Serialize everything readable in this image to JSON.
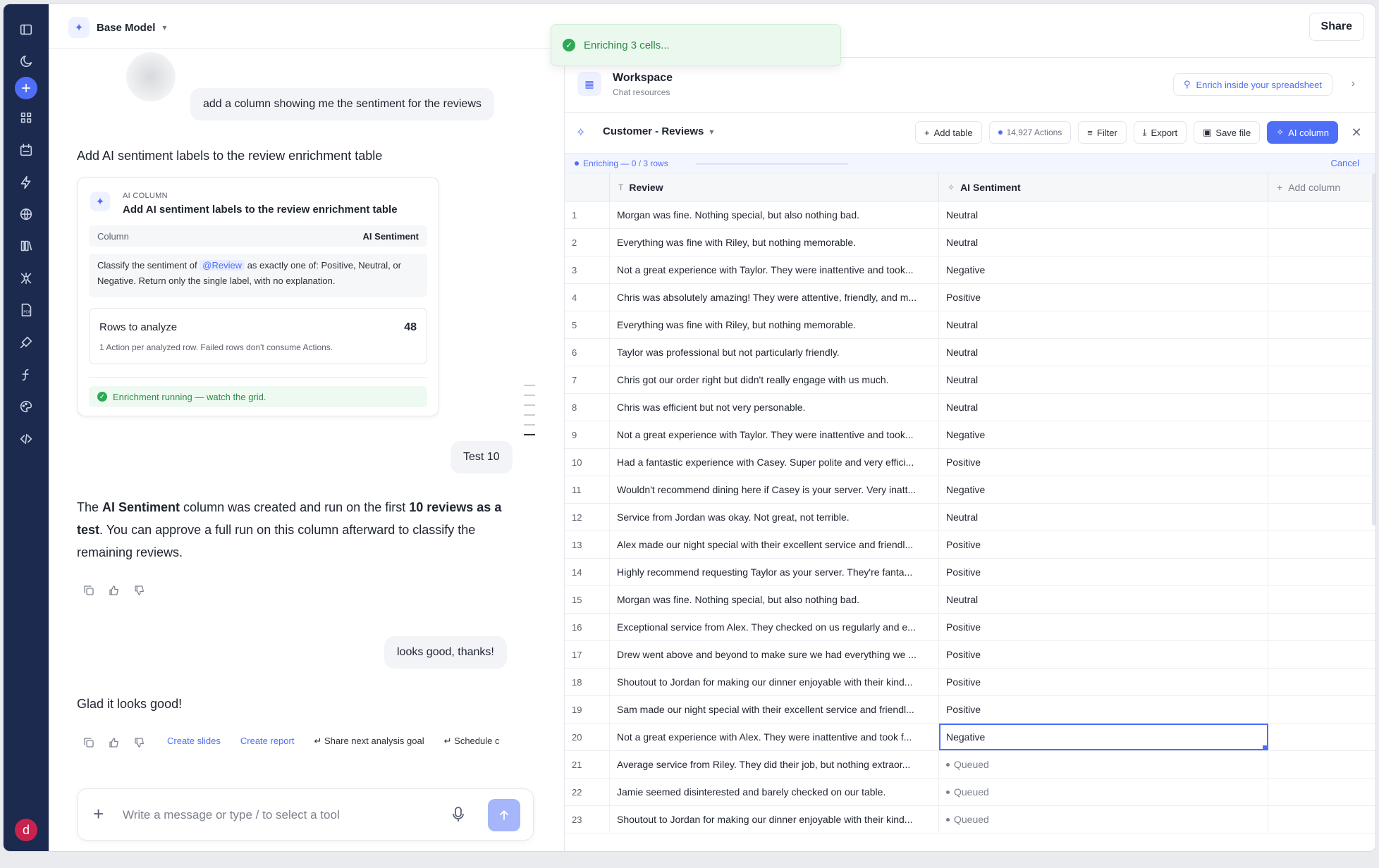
{
  "rail": {
    "items": [
      "sidebar-toggle-icon",
      "history-icon",
      "new-chat-icon",
      "apps-grid-icon",
      "calendar-icon",
      "bolt-icon",
      "globe-icon",
      "library-icon",
      "bug-icon",
      "pdf-icon",
      "plugin-icon",
      "function-icon",
      "palette-icon",
      "code-icon"
    ],
    "avatar": "d"
  },
  "header": {
    "model": "Base Model",
    "share": "Share"
  },
  "toast": {
    "text": "Enriching 3 cells..."
  },
  "chat": {
    "user_msg_1": "add a column showing me the sentiment for the reviews",
    "ai_heading": "Add AI sentiment labels to the review enrichment table",
    "card": {
      "eyebrow": "AI COLUMN",
      "title": "Add AI sentiment labels to the review enrichment table",
      "column_label": "Column",
      "column_value": "AI Sentiment",
      "prompt_before": "Classify the sentiment of",
      "prompt_mention": "@Review",
      "prompt_after": "as exactly one of: Positive, Neutral, or Negative. Return only the single label, with no explanation.",
      "rows_label": "Rows to analyze",
      "rows_value": "48",
      "rows_sub": "1 Action per analyzed row. Failed rows don't consume Actions.",
      "status": "Enrichment running — watch the grid."
    },
    "user_msg_2": "Test 10",
    "ai_reply": {
      "p1": "The ",
      "b1": "AI Sentiment",
      "p2": " column was created and run on the first ",
      "b2": "10 reviews as a test",
      "p3": ". You can approve a full run on this column afterward to classify the remaining reviews."
    },
    "user_msg_3": "looks good, thanks!",
    "ai_reply_2": "Glad it looks good!",
    "quick_actions": [
      "Create slides",
      "Create report",
      "Share next analysis goal",
      "Schedule c"
    ],
    "composer_placeholder": "Write a message or type / to select a tool"
  },
  "workspace": {
    "title": "Workspace",
    "subtitle": "Chat resources",
    "enrich_button": "Enrich inside your spreadsheet"
  },
  "table": {
    "name": "Customer - Reviews",
    "buttons": {
      "add_table": "Add table",
      "actions": "14,927 Actions",
      "filter": "Filter",
      "export": "Export",
      "save": "Save file",
      "ai_column": "AI column"
    },
    "progress": {
      "label": "Enriching — 0 / 3 rows",
      "fraction": 0.0,
      "cancel": "Cancel"
    },
    "columns": {
      "review": "Review",
      "sentiment": "AI Sentiment",
      "add": "Add column"
    },
    "rows": [
      {
        "n": "1",
        "review": "Morgan was fine. Nothing special, but also nothing bad.",
        "sentiment": "Neutral"
      },
      {
        "n": "2",
        "review": "Everything was fine with Riley, but nothing memorable.",
        "sentiment": "Neutral"
      },
      {
        "n": "3",
        "review": "Not a great experience with Taylor. They were inattentive and took...",
        "sentiment": "Negative"
      },
      {
        "n": "4",
        "review": "Chris was absolutely amazing! They were attentive, friendly, and m...",
        "sentiment": "Positive"
      },
      {
        "n": "5",
        "review": "Everything was fine with Riley, but nothing memorable.",
        "sentiment": "Neutral"
      },
      {
        "n": "6",
        "review": "Taylor was professional but not particularly friendly.",
        "sentiment": "Neutral"
      },
      {
        "n": "7",
        "review": "Chris got our order right but didn't really engage with us much.",
        "sentiment": "Neutral"
      },
      {
        "n": "8",
        "review": "Chris was efficient but not very personable.",
        "sentiment": "Neutral"
      },
      {
        "n": "9",
        "review": "Not a great experience with Taylor. They were inattentive and took...",
        "sentiment": "Negative"
      },
      {
        "n": "10",
        "review": "Had a fantastic experience with Casey. Super polite and very effici...",
        "sentiment": "Positive"
      },
      {
        "n": "11",
        "review": "Wouldn't recommend dining here if Casey is your server. Very inatt...",
        "sentiment": "Negative"
      },
      {
        "n": "12",
        "review": "Service from Jordan was okay. Not great, not terrible.",
        "sentiment": "Neutral"
      },
      {
        "n": "13",
        "review": "Alex made our night special with their excellent service and friendl...",
        "sentiment": "Positive"
      },
      {
        "n": "14",
        "review": "Highly recommend requesting Taylor as your server. They're fanta...",
        "sentiment": "Positive"
      },
      {
        "n": "15",
        "review": "Morgan was fine. Nothing special, but also nothing bad.",
        "sentiment": "Neutral"
      },
      {
        "n": "16",
        "review": "Exceptional service from Alex. They checked on us regularly and e...",
        "sentiment": "Positive"
      },
      {
        "n": "17",
        "review": "Drew went above and beyond to make sure we had everything we ...",
        "sentiment": "Positive"
      },
      {
        "n": "18",
        "review": "Shoutout to Jordan for making our dinner enjoyable with their kind...",
        "sentiment": "Positive"
      },
      {
        "n": "19",
        "review": "Sam made our night special with their excellent service and friendl...",
        "sentiment": "Positive"
      },
      {
        "n": "20",
        "review": "Not a great experience with Alex. They were inattentive and took f...",
        "sentiment": "Negative",
        "selected": true
      },
      {
        "n": "21",
        "review": "Average service from Riley. They did their job, but nothing extraor...",
        "sentiment": "Queued",
        "queued": true
      },
      {
        "n": "22",
        "review": "Jamie seemed disinterested and barely checked on our table.",
        "sentiment": "Queued",
        "queued": true
      },
      {
        "n": "23",
        "review": "Shoutout to Jordan for making our dinner enjoyable with their kind...",
        "sentiment": "Queued",
        "queued": true
      }
    ]
  },
  "colors": {
    "accent": "#4f6ef7",
    "rail": "#1b2a4e",
    "success": "#2fa855"
  }
}
